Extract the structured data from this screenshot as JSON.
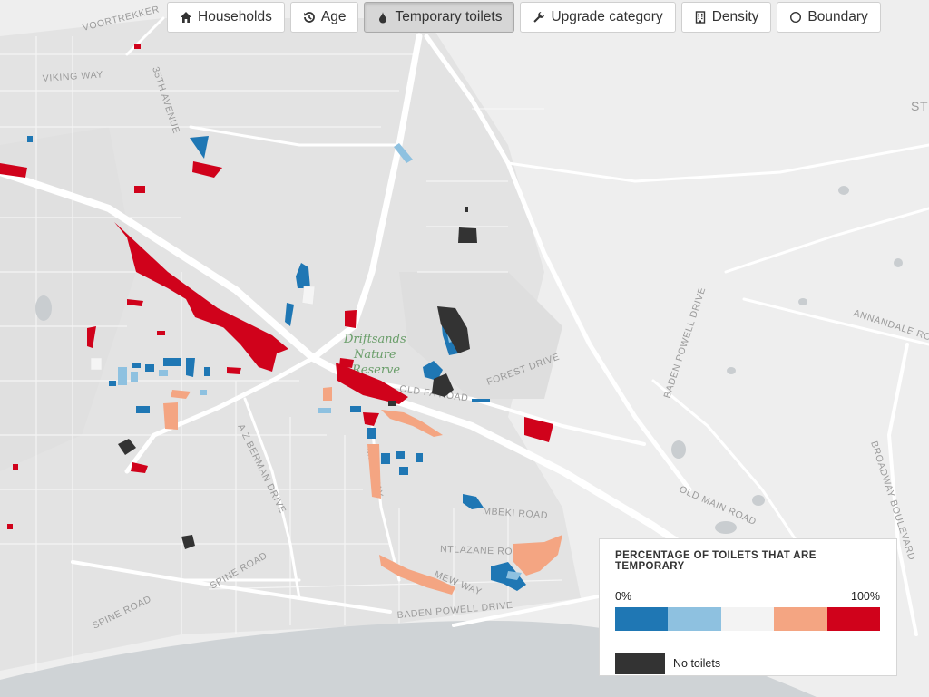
{
  "toolbar": {
    "buttons": [
      {
        "label": "Households",
        "icon": "home-icon",
        "active": false
      },
      {
        "label": "Age",
        "icon": "history-icon",
        "active": false
      },
      {
        "label": "Temporary toilets",
        "icon": "droplet-icon",
        "active": true
      },
      {
        "label": "Upgrade category",
        "icon": "wrench-icon",
        "active": false
      },
      {
        "label": "Density",
        "icon": "building-icon",
        "active": false
      },
      {
        "label": "Boundary",
        "icon": "circle-icon",
        "active": false
      }
    ]
  },
  "map": {
    "reserve_label_line1": "Driftsands",
    "reserve_label_line2": "Nature",
    "reserve_label_line3": "Reserve",
    "roads": {
      "voortrekker": "VOORTREKKER",
      "viking_way": "VIKING WAY",
      "avenue_35th": "35TH AVENUE",
      "old_faure": "OLD FA   ROAD",
      "forest_drive": "FOREST DRIVE",
      "baden_powell_drive": "BADEN POWELL DRIVE",
      "annandale": "ANNANDALE RO",
      "old_main_road": "OLD MAIN ROAD",
      "broadway": "BROADWAY BOULEVARD",
      "az_berman": "A Z BERMAN DRIVE",
      "mew_way_north": "MEW WAY",
      "mew_way_south": "MEW WAY",
      "spine_road_1": "SPINE ROAD",
      "spine_road_2": "SPINE ROAD",
      "mbeki": "MBEKI ROAD",
      "ntlazane": "NTLAZANE RO",
      "baden_powell_south": "BADEN POWELL DRIVE",
      "st_partial": "ST"
    },
    "colors": {
      "land": "#eeeeee",
      "water": "#cfd3d6",
      "road": "#ffffff",
      "dark_blue": "#1f77b4",
      "light_blue": "#8ec1e0",
      "neutral": "#f3f3f3",
      "salmon": "#f4a582",
      "red": "#d0021b",
      "no_toilets": "#333333"
    }
  },
  "legend": {
    "title": "PERCENTAGE OF TOILETS THAT ARE TEMPORARY",
    "min_label": "0%",
    "max_label": "100%",
    "ramp": [
      "#1f77b4",
      "#8ec1e0",
      "#f3f3f3",
      "#f4a582",
      "#d0021b"
    ],
    "no_toilets_label": "No toilets",
    "no_toilets_color": "#333333"
  }
}
